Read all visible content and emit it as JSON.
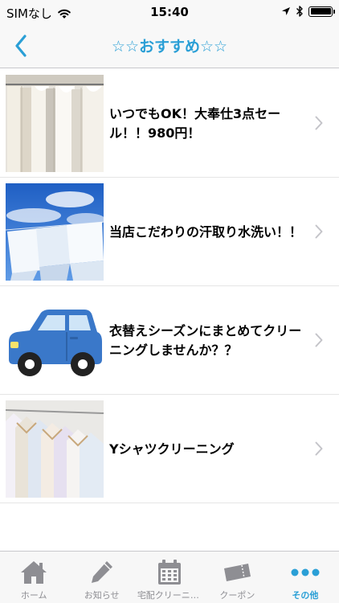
{
  "status_bar": {
    "carrier": "SIMなし",
    "time": "15:40"
  },
  "nav": {
    "title": "☆☆おすすめ☆☆",
    "back_icon": "chevron-left-icon",
    "accent_color": "#2a9fd6"
  },
  "items": [
    {
      "title": "いつでもOK！大奉仕3点セール！！980円！",
      "image": "hanging-white-shirts-photo"
    },
    {
      "title": "当店こだわりの汗取り水洗い！！",
      "image": "laundry-sky-photo"
    },
    {
      "title": "衣替えシーズンにまとめてクリーニングしませんか？？",
      "image": "blue-car-illustration"
    },
    {
      "title": "Yシャツクリーニング",
      "image": "dress-shirts-rack-photo"
    }
  ],
  "tab_bar": {
    "tabs": [
      {
        "label": "ホーム",
        "icon": "home-icon",
        "active": false
      },
      {
        "label": "お知らせ",
        "icon": "pencil-icon",
        "active": false
      },
      {
        "label": "宅配クリーニング",
        "icon": "calendar-icon",
        "active": false
      },
      {
        "label": "クーポン",
        "icon": "ticket-icon",
        "active": false
      },
      {
        "label": "その他",
        "icon": "more-icon",
        "active": true
      }
    ]
  }
}
